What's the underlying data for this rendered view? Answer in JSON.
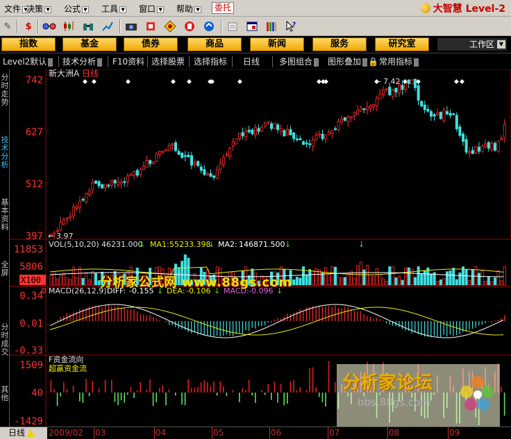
{
  "menu": {
    "items": [
      "文件",
      "决策",
      "公式",
      "工具",
      "窗口",
      "帮助"
    ],
    "entrust": "委托",
    "brand": "大智慧",
    "brand_edition": "Level-2"
  },
  "toolbar": {
    "icons": [
      "pencil-icon",
      "dollar-icon",
      "glasses-icon",
      "candlestick-icon",
      "binoculars-icon",
      "pencil-chart-icon",
      "camera-icon",
      "stock-red-icon",
      "diamond-icon",
      "hammer-icon",
      "blue-circle-icon",
      "scroll-icon",
      "window-icon",
      "books-icon",
      "help-cursor-icon"
    ]
  },
  "nav": {
    "buttons": [
      "指数",
      "基金",
      "债券",
      "商品",
      "新闻",
      "服务",
      "研究室"
    ],
    "workspace": "工作区"
  },
  "tabs": {
    "items": [
      "Level2默认",
      "技术分析",
      "F10资料",
      "选择股票",
      "选择指标",
      "日线",
      "多图组合",
      "图形叠加",
      "常用指标"
    ]
  },
  "side_tabs": [
    "分时走势",
    "技术分析",
    "基本资料",
    "全屏",
    "分时成交",
    "其他"
  ],
  "chart": {
    "stock_name": "新大洲A",
    "period": "日线",
    "price_axis": [
      "742",
      "627",
      "512",
      "397"
    ],
    "high_label": "7.42",
    "low_label": "3.97",
    "volume": {
      "title": "VOL(5,10,20)",
      "value": "46231.000",
      "ma1_label": "MA1:",
      "ma1": "55233.398",
      "ma2_label": "MA2:",
      "ma2": "146871.500",
      "axis": [
        "11853",
        "5806"
      ],
      "unit": "X100"
    },
    "macd": {
      "title": "MACD(26,12,9)",
      "diff_label": "DIFF:",
      "diff": "-0.155",
      "dea_label": "DEA:",
      "dea": "-0.106",
      "macd_label": "MACD:",
      "macd": "-0.096",
      "axis": [
        "0.34",
        "0.01",
        "-0.33"
      ]
    },
    "fund": {
      "title": "F资金流向",
      "subtitle": "超赢资金流",
      "axis": [
        "1509",
        "40",
        "-1429"
      ]
    },
    "dates": [
      "2009/02",
      "03",
      "04",
      "05",
      "06",
      "07",
      "08",
      "09"
    ]
  },
  "bottom": {
    "period_tab": "日线"
  },
  "watermarks": {
    "primary": "分析家公式网  www.88gs.com",
    "forum": "分析家论坛",
    "forum_url": "bbs.88gs.com"
  },
  "colors": {
    "up": "#ff3030",
    "down": "#40e0e0",
    "axis": "#c00000",
    "ma_yellow": "#f0f000",
    "ma_white": "#ffffff"
  }
}
